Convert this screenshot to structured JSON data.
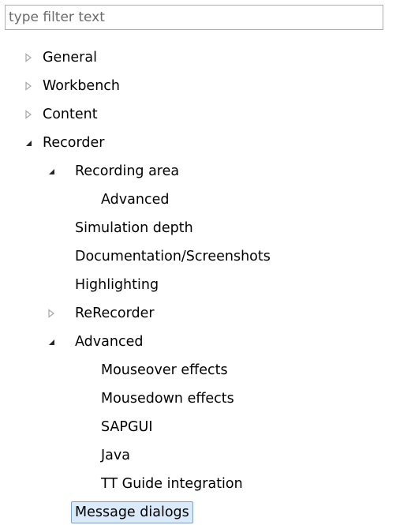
{
  "filter": {
    "placeholder": "type filter text",
    "value": ""
  },
  "tree": {
    "nodes": [
      {
        "label": "General",
        "level": 0,
        "expander": "collapsed"
      },
      {
        "label": "Workbench",
        "level": 0,
        "expander": "collapsed"
      },
      {
        "label": "Content",
        "level": 0,
        "expander": "collapsed"
      },
      {
        "label": "Recorder",
        "level": 0,
        "expander": "expanded"
      },
      {
        "label": "Recording area",
        "level": 1,
        "expander": "expanded"
      },
      {
        "label": "Advanced",
        "level": 2,
        "expander": "none"
      },
      {
        "label": "Simulation depth",
        "level": 1,
        "expander": "none"
      },
      {
        "label": "Documentation/Screenshots",
        "level": 1,
        "expander": "none"
      },
      {
        "label": "Highlighting",
        "level": 1,
        "expander": "none"
      },
      {
        "label": "ReRecorder",
        "level": 1,
        "expander": "collapsed"
      },
      {
        "label": "Advanced",
        "level": 1,
        "expander": "expanded"
      },
      {
        "label": "Mouseover effects",
        "level": 2,
        "expander": "none"
      },
      {
        "label": "Mousedown effects",
        "level": 2,
        "expander": "none"
      },
      {
        "label": "SAPGUI",
        "level": 2,
        "expander": "none"
      },
      {
        "label": "Java",
        "level": 2,
        "expander": "none"
      },
      {
        "label": "TT Guide integration",
        "level": 2,
        "expander": "none"
      },
      {
        "label": "Message dialogs",
        "level": 1,
        "expander": "none",
        "selected": true
      }
    ]
  }
}
